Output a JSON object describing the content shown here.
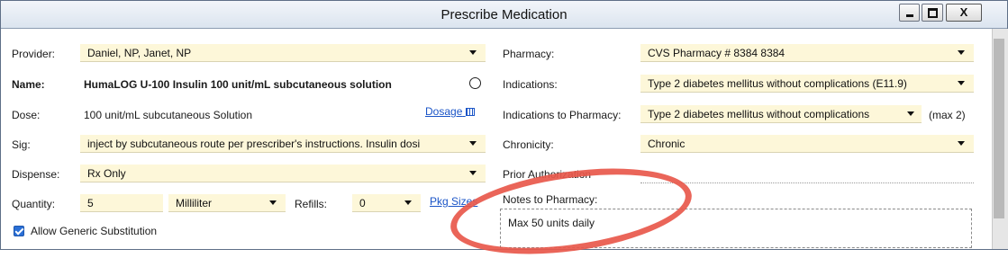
{
  "window": {
    "title": "Prescribe Medication",
    "close_label": "X"
  },
  "left": {
    "provider_label": "Provider:",
    "provider_value": "Daniel, NP, Janet, NP",
    "name_label": "Name:",
    "name_value": "HumaLOG U-100 Insulin 100 unit/mL subcutaneous solution",
    "dose_label": "Dose:",
    "dose_value": "100 unit/mL subcutaneous Solution",
    "dosage_link": "Dosage",
    "sig_label": "Sig:",
    "sig_value": "inject by subcutaneous route per prescriber's instructions. Insulin dosi",
    "dispense_label": "Dispense:",
    "dispense_value": "Rx Only",
    "quantity_label": "Quantity:",
    "quantity_value": "5",
    "unit_value": "Milliliter",
    "refills_label": "Refills:",
    "refills_value": "0",
    "pkg_sizes_link": "Pkg Sizes",
    "generic_label": "Allow Generic Substitution",
    "generic_checked": true
  },
  "right": {
    "pharmacy_label": "Pharmacy:",
    "pharmacy_value": "CVS Pharmacy # 8384 8384",
    "indications_label": "Indications:",
    "indications_value": "Type 2 diabetes mellitus without complications (E11.9)",
    "ind_pharmacy_label": "Indications to Pharmacy:",
    "ind_pharmacy_value": "Type 2 diabetes mellitus without complications",
    "ind_pharmacy_max": "(max 2)",
    "chronicity_label": "Chronicity:",
    "chronicity_value": "Chronic",
    "prior_auth_label": "Prior Authorization",
    "notes_label": "Notes to Pharmacy:",
    "notes_value": "Max 50 units daily"
  },
  "colors": {
    "field_bg": "#fdf7d9",
    "link": "#1a54c7",
    "annotation": "#e8584b"
  }
}
